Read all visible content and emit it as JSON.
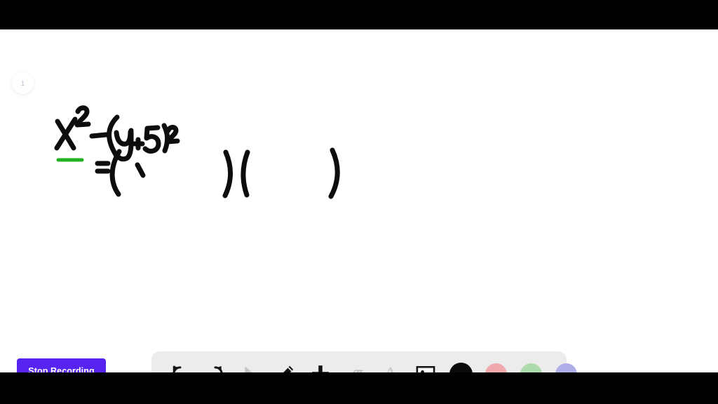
{
  "app": {
    "background_color": "#000000",
    "canvas_color": "#ffffff"
  },
  "page_indicator": {
    "label": "1"
  },
  "recording": {
    "stop_label": "Stop Recording",
    "button_color": "#5724ef"
  },
  "whiteboard": {
    "handwriting": {
      "line1": "x² − (y + 5)²",
      "line2": "= ( ` ) ( )",
      "underline_color": "#22b022",
      "ink_color": "#000000"
    }
  },
  "toolbar": {
    "background_color": "#ececec",
    "tools": [
      {
        "name": "undo-tool",
        "label": "Undo",
        "icon": "undo-icon",
        "state": "enabled"
      },
      {
        "name": "redo-tool",
        "label": "Redo",
        "icon": "redo-icon",
        "state": "enabled"
      },
      {
        "name": "select-tool",
        "label": "Select",
        "icon": "cursor-icon",
        "state": "inactive"
      },
      {
        "name": "pen-tool",
        "label": "Pen",
        "icon": "pencil-icon",
        "state": "active"
      },
      {
        "name": "add-tool",
        "label": "Add",
        "icon": "plus-icon",
        "state": "enabled"
      },
      {
        "name": "eraser-tool",
        "label": "Eraser",
        "icon": "eraser-icon",
        "state": "inactive"
      },
      {
        "name": "text-tool",
        "label": "Text",
        "icon": "text-a-icon",
        "state": "inactive"
      },
      {
        "name": "image-tool",
        "label": "Image",
        "icon": "image-icon",
        "state": "enabled"
      }
    ],
    "colors": [
      {
        "name": "color-black",
        "label": "Black",
        "hex": "#0a0a0a",
        "selected": true
      },
      {
        "name": "color-pink",
        "label": "Pink",
        "hex": "#f0a8ae",
        "selected": false
      },
      {
        "name": "color-green",
        "label": "Green",
        "hex": "#aedbae",
        "selected": false
      },
      {
        "name": "color-purple",
        "label": "Purple",
        "hex": "#b0aee8",
        "selected": false
      }
    ]
  }
}
